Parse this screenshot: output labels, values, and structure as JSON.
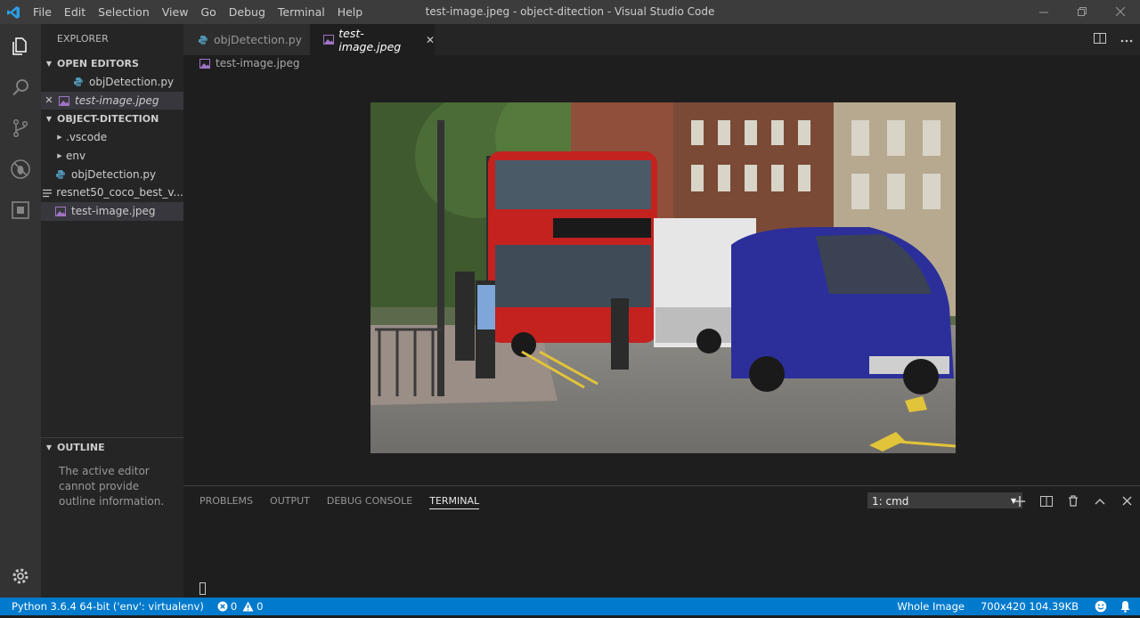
{
  "titlebar": {
    "menu": [
      "File",
      "Edit",
      "Selection",
      "View",
      "Go",
      "Debug",
      "Terminal",
      "Help"
    ],
    "title": "test-image.jpeg - object-ditection - Visual Studio Code"
  },
  "sidebar": {
    "header": "EXPLORER",
    "open_editors_label": "OPEN EDITORS",
    "open_editors": [
      {
        "name": "objDetection.py"
      },
      {
        "name": "test-image.jpeg"
      }
    ],
    "folder_label": "OBJECT-DITECTION",
    "folder_items": [
      {
        "name": ".vscode"
      },
      {
        "name": "env"
      },
      {
        "name": "objDetection.py"
      },
      {
        "name": "resnet50_coco_best_v..."
      },
      {
        "name": "test-image.jpeg"
      }
    ],
    "outline_label": "OUTLINE",
    "outline_message": "The active editor cannot provide outline information."
  },
  "tabs": [
    {
      "label": "objDetection.py"
    },
    {
      "label": "test-image.jpeg"
    }
  ],
  "breadcrumb": "test-image.jpeg",
  "panel": {
    "tabs": [
      "PROBLEMS",
      "OUTPUT",
      "DEBUG CONSOLE",
      "TERMINAL"
    ],
    "terminal_select": "1: cmd"
  },
  "statusbar": {
    "python": "Python 3.6.4 64-bit ('env': virtualenv)",
    "errors": "0",
    "warnings": "0",
    "zoom": "Whole Image",
    "image_info": "700x420 104.39KB"
  },
  "colors": {
    "accent": "#007acc",
    "python_icon": "#519aba",
    "image_icon": "#a074c4"
  }
}
